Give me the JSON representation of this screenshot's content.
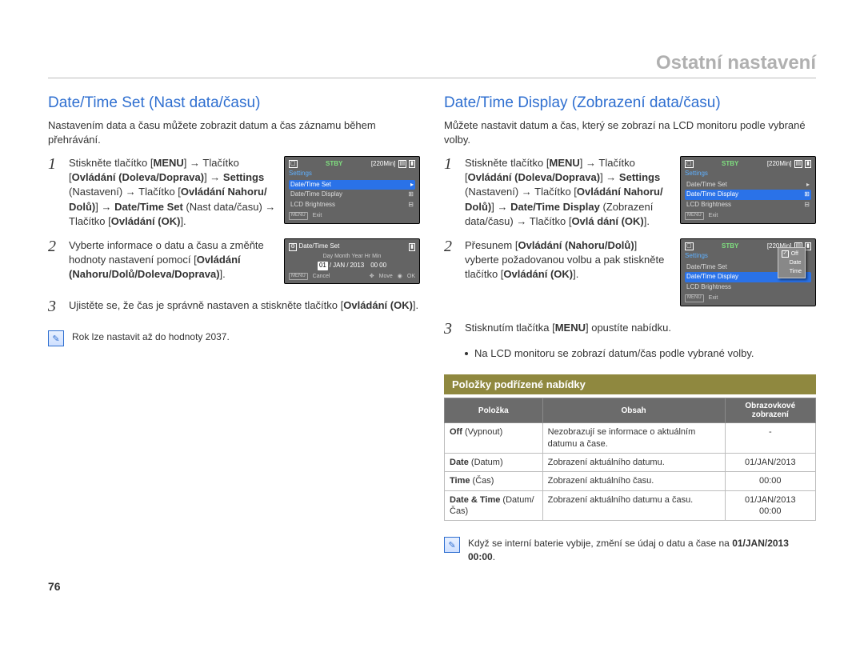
{
  "header": {
    "title": "Ostatní nastavení",
    "page_number": "76"
  },
  "left": {
    "heading": "Date/Time Set (Nast data/času)",
    "intro": "Nastavením data a času můžete zobrazit datum a čas záznamu během přehrávání.",
    "step1": {
      "num": "1",
      "p1a": "Stiskněte tlačítko [",
      "p1b": "MENU",
      "p1c": "] → Tlačítko [",
      "p1d": "Ovládání (Doleva/Doprava)",
      "p1e": "] → ",
      "p1f": "Settings",
      "p1g": " (Nastavení) → Tlačítko [",
      "p1h": "Ovládání Nahoru/ Dolů)",
      "p1i": "] → ",
      "p1j": "Date/Time Set",
      "p1k": " (Nast data/času) → Tlačítko [",
      "p1l": "Ovládání (OK)",
      "p1m": "]."
    },
    "step2": {
      "num": "2",
      "p2a": "Vyberte informace o datu a času a změňte hodnoty nastavení pomocí [",
      "p2b": "Ovládání (Nahoru/Dolů/Doleva/Doprava)",
      "p2c": "]."
    },
    "step3": {
      "num": "3",
      "p3a": "Ujistěte se, že čas je správně nastaven a stiskněte tlačítko [",
      "p3b": "Ovládání (OK)",
      "p3c": "]."
    },
    "note": "Rok lze nastavit až do hodnoty 2037.",
    "panel1": {
      "stby": "STBY",
      "time": "[220Min]",
      "settings": "Settings",
      "row_sel": "Date/Time Set",
      "row2": "Date/Time Display",
      "row3": "LCD Brightness",
      "menu": "MENU",
      "exit": "Exit"
    },
    "panel2": {
      "title": "Date/Time Set",
      "labels": {
        "day": "Day",
        "month": "Month",
        "year": "Year",
        "hr": "Hr",
        "min": "Min"
      },
      "vals": {
        "day": "01",
        "sep1": "/",
        "month": "JAN",
        "sep2": "/",
        "year": "2013",
        "hr": "00",
        "min": "00"
      },
      "menu": "MENU",
      "cancel": "Cancel",
      "move": "Move",
      "ok": "OK"
    }
  },
  "right": {
    "heading": "Date/Time Display (Zobrazení data/času)",
    "intro": "Můžete nastavit datum a čas, který se zobrazí na LCD monitoru podle vybrané volby.",
    "step1": {
      "num": "1",
      "p1a": "Stiskněte tlačítko [",
      "p1b": "MENU",
      "p1c": "] → Tlačítko [",
      "p1d": "Ovládání (Doleva/Doprava)",
      "p1e": "] → ",
      "p1f": "Settings",
      "p1g": " (Nastavení) → Tlačítko [",
      "p1h": "Ovládání Nahoru/ Dolů)",
      "p1i": "] → ",
      "p1j": "Date/Time Display",
      "p1k": " (Zobrazení data/času) → Tlačítko [",
      "p1l": "Ovlá dání (OK)",
      "p1m": "]."
    },
    "step2": {
      "num": "2",
      "p2a": "Přesunem [",
      "p2b": "Ovládání (Nahoru/Dolů)",
      "p2c": "] vyberte požadovanou volbu a pak stiskněte tlačítko [",
      "p2d": "Ovládání (OK)",
      "p2e": "]."
    },
    "step3": {
      "num": "3",
      "p3a": "Stisknutím tlačítka [",
      "p3b": "MENU",
      "p3c": "] opustíte nabídku."
    },
    "bullet": "Na LCD monitoru se zobrazí datum/čas podle vybrané volby.",
    "subhead": "Položky podřízené nabídky",
    "table": {
      "th1": "Položka",
      "th2": "Obsah",
      "th3": "Obrazovkové zobrazení",
      "rows": [
        {
          "c1b": "Off",
          "c1": " (Vypnout)",
          "c2": "Nezobrazují se informace o aktuálním datumu a čase.",
          "c3": "-"
        },
        {
          "c1b": "Date",
          "c1": " (Datum)",
          "c2": "Zobrazení aktuálního datumu.",
          "c3": "01/JAN/2013"
        },
        {
          "c1b": "Time",
          "c1": " (Čas)",
          "c2": "Zobrazení aktuálního času.",
          "c3": "00:00"
        },
        {
          "c1b": "Date & Time",
          "c1": " (Datum/Čas)",
          "c2": "Zobrazení aktuálního datumu a času.",
          "c3": "01/JAN/2013\n00:00"
        }
      ]
    },
    "note_a": "Když se interní baterie vybije, změní se údaj o datu a čase na ",
    "note_b": "01/JAN/2013 00:00",
    "note_c": ".",
    "panel1": {
      "stby": "STBY",
      "time": "[220Min]",
      "settings": "Settings",
      "row1": "Date/Time Set",
      "row_sel": "Date/Time Display",
      "row3": "LCD Brightness",
      "menu": "MENU",
      "exit": "Exit"
    },
    "panel2": {
      "stby": "STBY",
      "time": "[220Min]",
      "settings": "Settings",
      "row1": "Date/Time Set",
      "row_sel": "Date/Time Display",
      "row3": "LCD Brightness",
      "menu": "MENU",
      "exit": "Exit",
      "popup": {
        "off": "Off",
        "date": "Date",
        "time": "Time"
      }
    }
  }
}
